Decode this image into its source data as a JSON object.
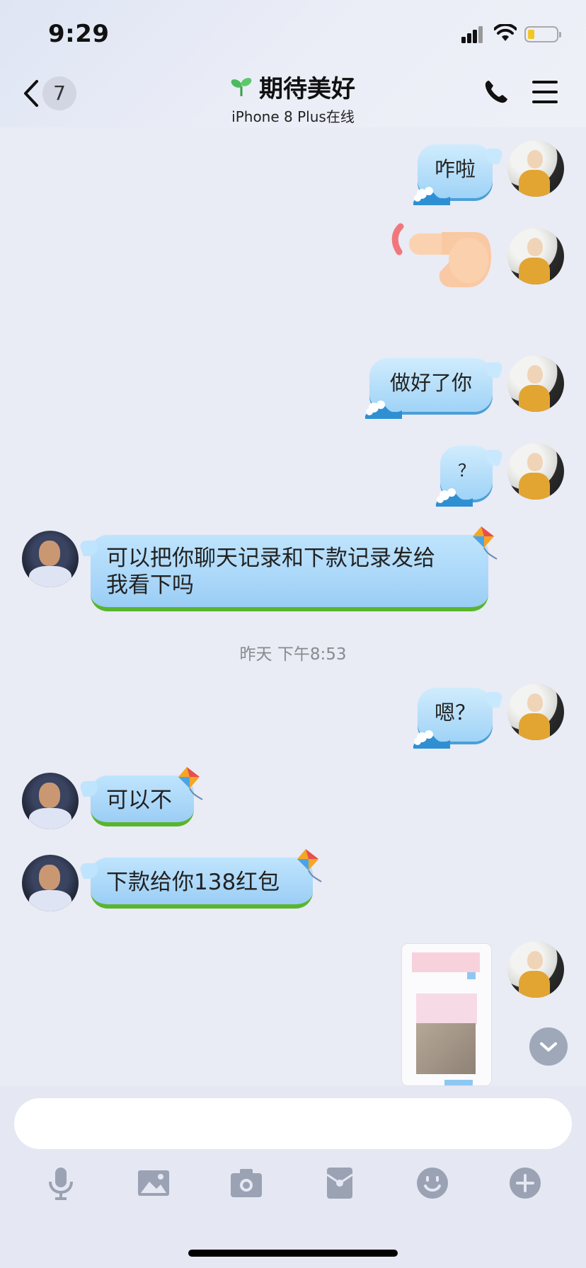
{
  "status_bar": {
    "time": "9:29"
  },
  "header": {
    "back_count": "7",
    "title": "期待美好",
    "subtitle": "iPhone 8 Plus在线"
  },
  "messages": [
    {
      "side": "out",
      "type": "text",
      "text": "咋啦"
    },
    {
      "side": "out",
      "type": "sticker",
      "sticker": "pointing-hand"
    },
    {
      "side": "out",
      "type": "text",
      "text": "做好了你"
    },
    {
      "side": "out",
      "type": "text",
      "text": "？"
    },
    {
      "side": "in",
      "type": "text",
      "lines": [
        "可以把你聊天记录和下款记录发给",
        "我看下吗"
      ]
    },
    {
      "side": "out",
      "type": "text",
      "text": "嗯？"
    },
    {
      "side": "in",
      "type": "text",
      "text": "可以不"
    },
    {
      "side": "in",
      "type": "text",
      "text": "下款给你138红包"
    },
    {
      "side": "out",
      "type": "image",
      "image": "chat-screenshot"
    }
  ],
  "timestamp": "昨天 下午8:53",
  "input": {
    "placeholder": ""
  },
  "toolbar": [
    "microphone-icon",
    "image-icon",
    "camera-icon",
    "red-packet-icon",
    "emoji-icon",
    "plus-icon"
  ],
  "colors": {
    "background": "#e9ebf5",
    "bubble_out": "#a8d8f8",
    "bubble_in": "#b4ddfb",
    "grass_border": "#59b52d",
    "icon_gray": "#9aa2b4"
  }
}
